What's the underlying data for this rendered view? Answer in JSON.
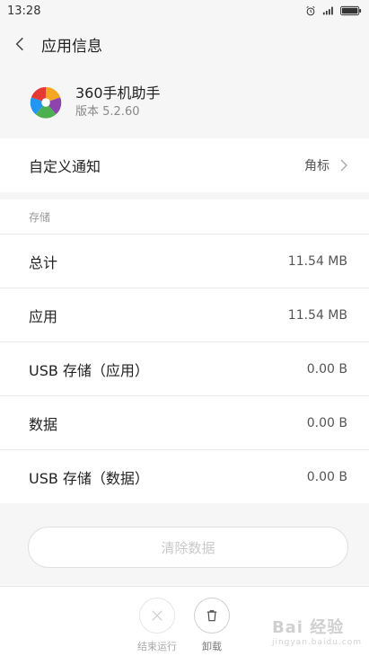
{
  "statusbar": {
    "time": "13:28"
  },
  "titlebar": {
    "title": "应用信息"
  },
  "app": {
    "name": "360手机助手",
    "version": "版本 5.2.60"
  },
  "notification": {
    "label": "自定义通知",
    "value": "角标"
  },
  "storage": {
    "section_title": "存储",
    "rows": [
      {
        "label": "总计",
        "value": "11.54 MB"
      },
      {
        "label": "应用",
        "value": "11.54 MB"
      },
      {
        "label": "USB 存储（应用）",
        "value": "0.00 B"
      },
      {
        "label": "数据",
        "value": "0.00 B"
      },
      {
        "label": "USB 存储（数据）",
        "value": "0.00 B"
      }
    ]
  },
  "clear_button": {
    "label": "清除数据"
  },
  "actions": {
    "force_stop": "结束运行",
    "uninstall": "卸载"
  },
  "watermark": {
    "text": "Bai 经验",
    "sub": "jingyan.baidu.com"
  },
  "colors": {
    "background": "#f6f6f6",
    "card": "#ffffff",
    "muted_text": "#999999"
  }
}
